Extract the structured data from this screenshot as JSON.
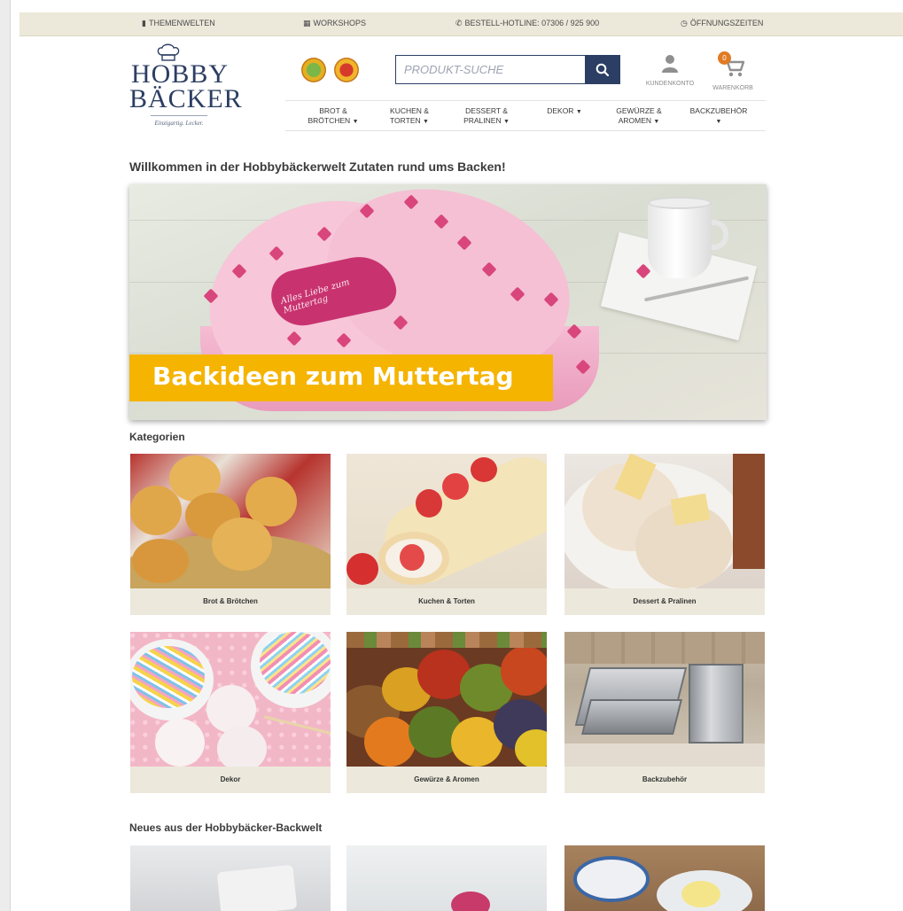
{
  "topbar": {
    "themenwelten": "THEMENWELTEN",
    "workshops": "WORKSHOPS",
    "hotline": "BESTELL-HOTLINE: 07306 / 925 900",
    "oeffnungszeiten": "ÖFFNUNGSZEITEN"
  },
  "logo": {
    "line1": "HOBBY",
    "line2": "BÄCKER",
    "tagline": "Einzigartig. Lecker."
  },
  "search": {
    "placeholder": "PRODUKT-SUCHE"
  },
  "account": {
    "label": "KUNDENKONTO"
  },
  "cart": {
    "label": "WARENKORB",
    "count": "0"
  },
  "nav": {
    "items": [
      {
        "line1": "BROT &",
        "line2": "BRÖTCHEN"
      },
      {
        "line1": "KUCHEN &",
        "line2": "TORTEN"
      },
      {
        "line1": "DESSERT &",
        "line2": "PRALINEN"
      },
      {
        "line1": "DEKOR",
        "line2": ""
      },
      {
        "line1": "GEWÜRZE &",
        "line2": "AROMEN"
      },
      {
        "line1": "BACKZUBEHÖR",
        "line2": ""
      }
    ]
  },
  "welcome": {
    "title": "Willkommen in der Hobbybäckerwelt Zutaten rund ums Backen!"
  },
  "hero": {
    "banner": "Backideen zum Muttertag",
    "plaque": "Alles Liebe zum Muttertag"
  },
  "categories": {
    "heading": "Kategorien",
    "items": [
      {
        "label": "Brot & Brötchen"
      },
      {
        "label": "Kuchen & Torten"
      },
      {
        "label": "Dessert & Pralinen"
      },
      {
        "label": "Dekor"
      },
      {
        "label": "Gewürze & Aromen"
      },
      {
        "label": "Backzubehör"
      }
    ]
  },
  "news": {
    "heading": "Neues aus der Hobbybäcker-Backwelt"
  },
  "colors": {
    "brand_navy": "#2c3e63",
    "topbar_bg": "#ece8da",
    "banner_yellow": "#f5b400",
    "cart_badge": "#e07b24"
  }
}
